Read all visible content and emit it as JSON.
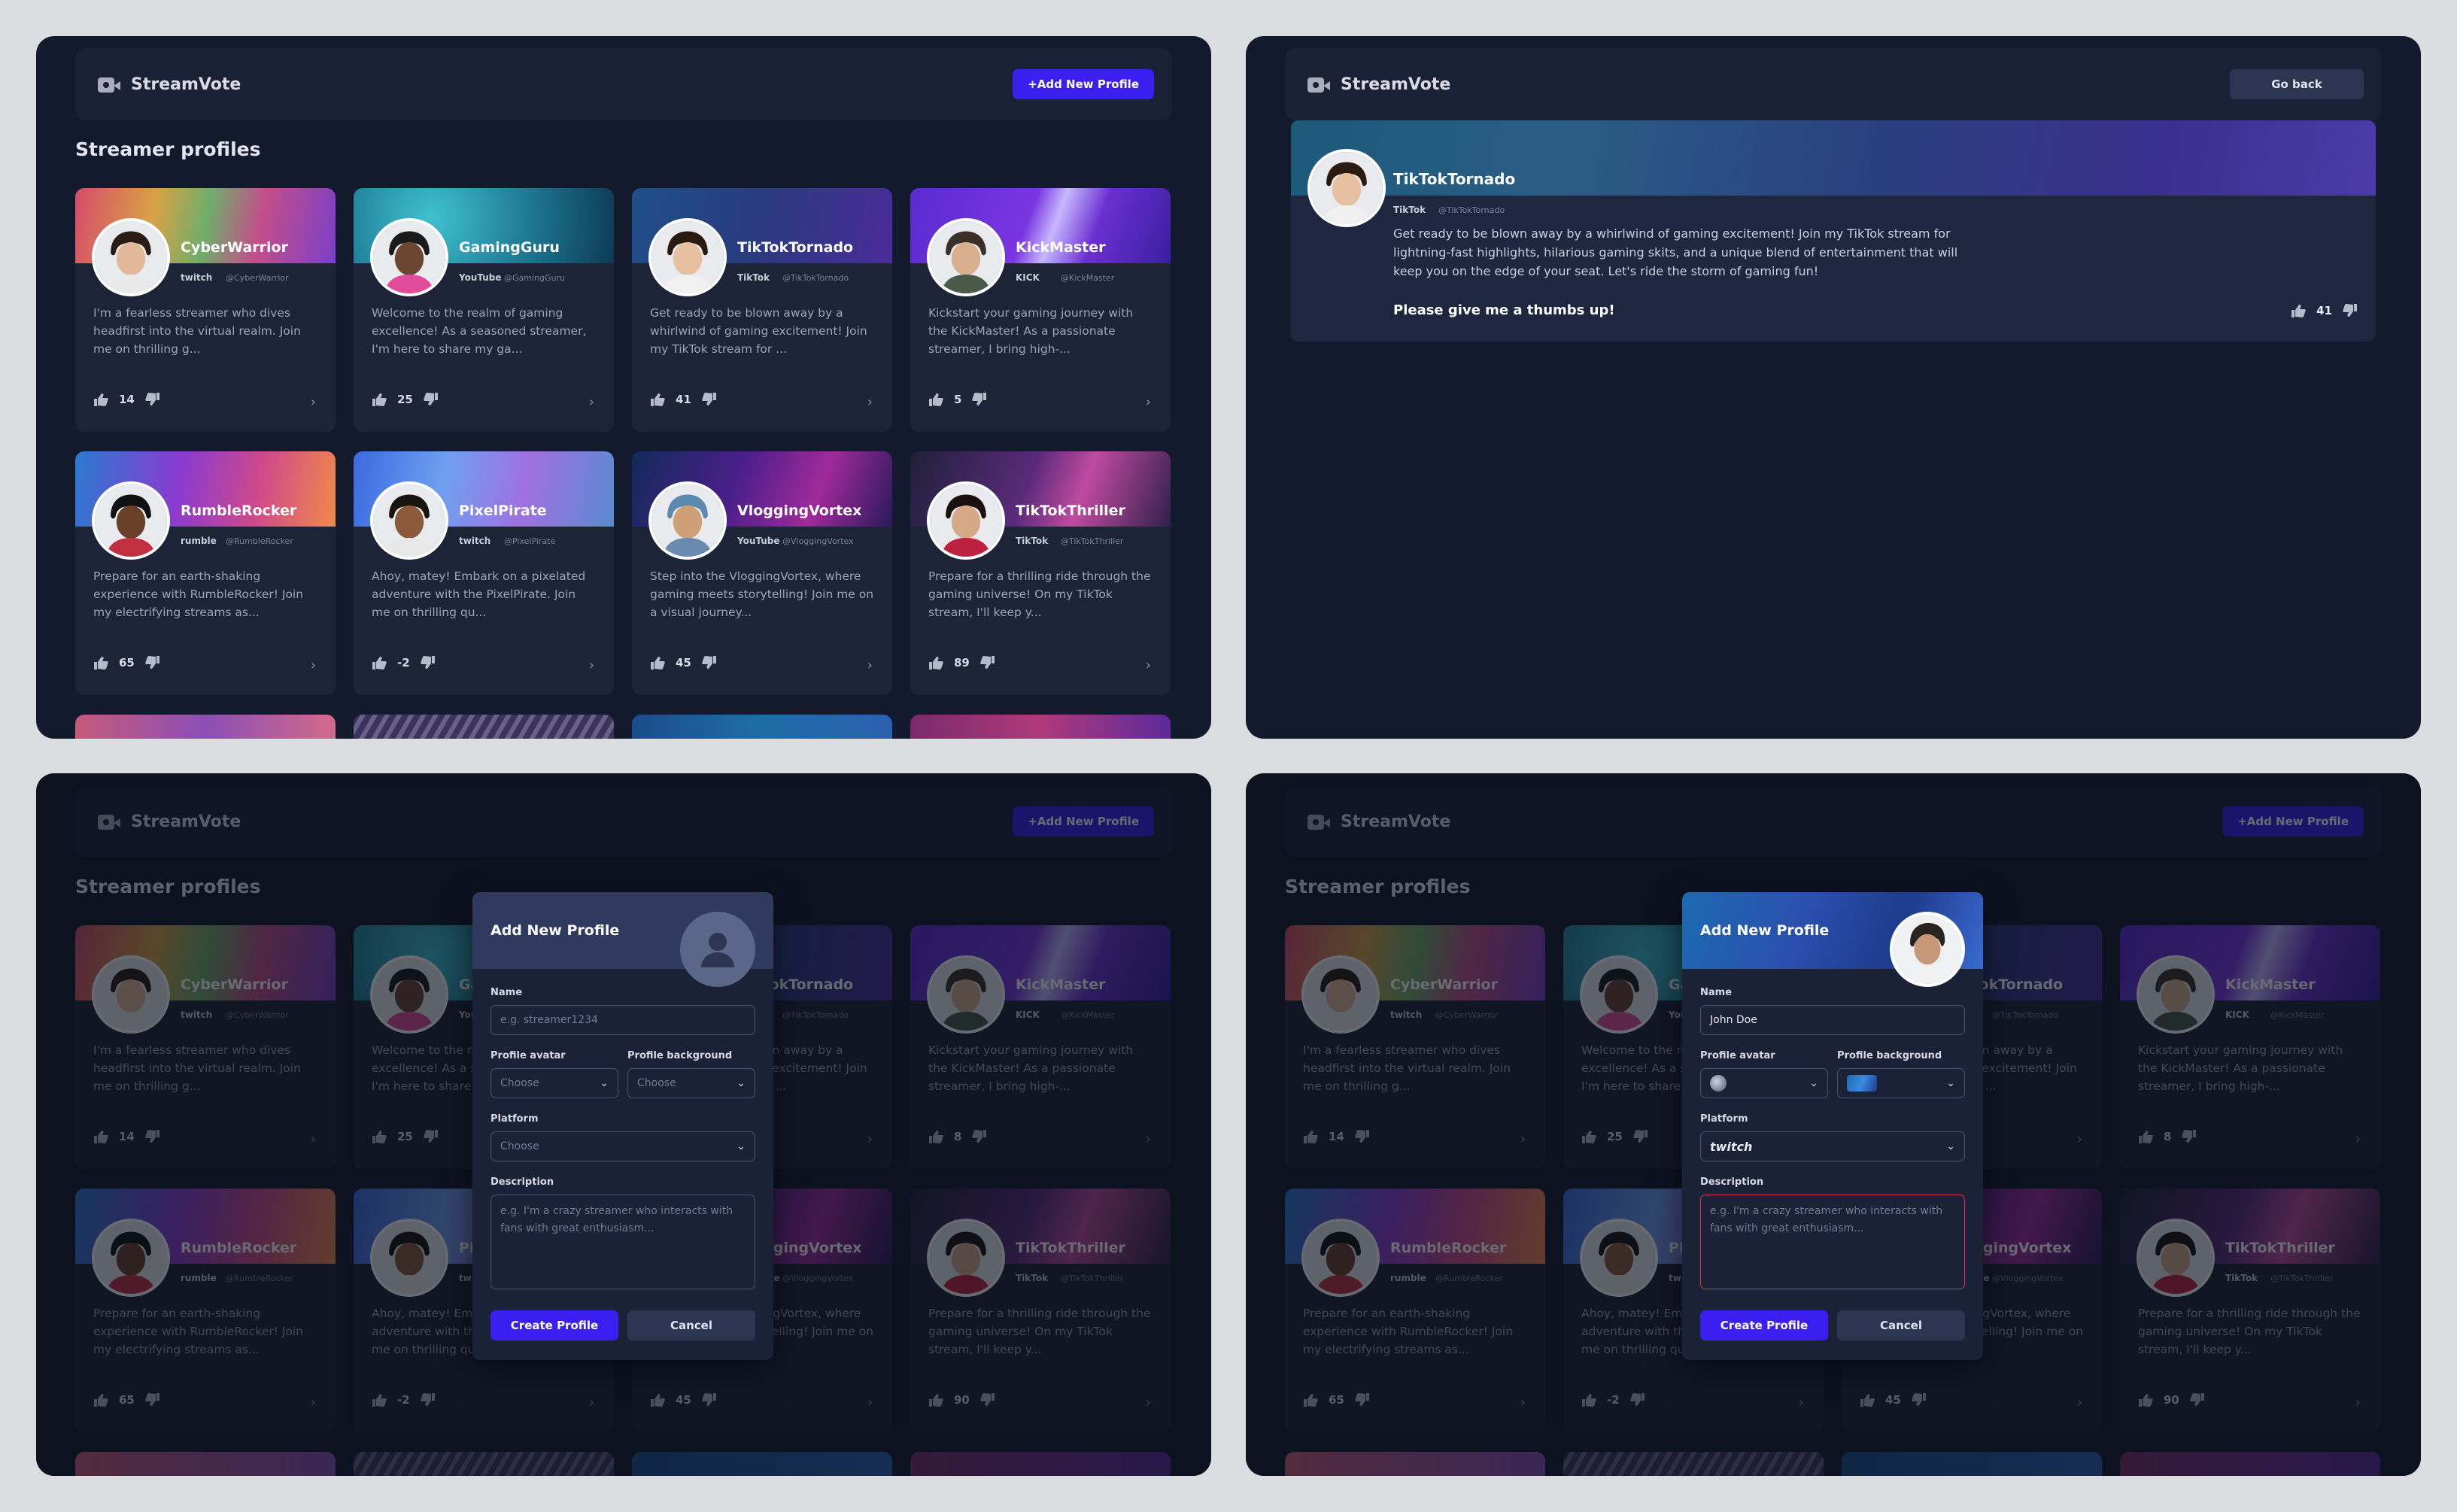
{
  "app": {
    "brand": "StreamVote"
  },
  "header": {
    "add_profile_label": "+Add New Profile",
    "go_back_label": "Go back"
  },
  "list": {
    "title": "Streamer profiles"
  },
  "profiles": [
    {
      "name": "CyberWarrior",
      "platform": "twitch",
      "handle": "@CyberWarrior",
      "description": "I'm a fearless streamer who dives headfirst into the virtual realm. Join me on thrilling g...",
      "votes": "14"
    },
    {
      "name": "GamingGuru",
      "platform": "YouTube",
      "handle": "@GamingGuru",
      "description": "Welcome to the realm of gaming excellence! As a seasoned streamer, I'm here to share my ga...",
      "votes": "25"
    },
    {
      "name": "TikTokTornado",
      "platform": "TikTok",
      "handle": "@TikTokTornado",
      "description": "Get ready to be blown away by a whirlwind of gaming excitement! Join my TikTok stream for ...",
      "votes": "41"
    },
    {
      "name": "KickMaster",
      "platform": "KICK",
      "handle": "@KickMaster",
      "description": "Kickstart your gaming journey with the KickMaster! As a passionate streamer, I bring high-...",
      "votes": "5"
    },
    {
      "name": "RumbleRocker",
      "platform": "rumble",
      "handle": "@RumbleRocker",
      "description": "Prepare for an earth-shaking experience with RumbleRocker! Join my electrifying streams as...",
      "votes": "65"
    },
    {
      "name": "PixelPirate",
      "platform": "twitch",
      "handle": "@PixelPirate",
      "description": "Ahoy, matey! Embark on a pixelated adventure with the PixelPirate. Join me on thrilling qu...",
      "votes": "-2"
    },
    {
      "name": "VloggingVortex",
      "platform": "YouTube",
      "handle": "@VloggingVortex",
      "description": "Step into the VloggingVortex, where gaming meets storytelling! Join me on a visual journey...",
      "votes": "45"
    },
    {
      "name": "TikTokThriller",
      "platform": "TikTok",
      "handle": "@TikTokThriller",
      "description": "Prepare for a thrilling ride through the gaming universe! On my TikTok stream, I'll keep y...",
      "votes": "89"
    }
  ],
  "detail": {
    "name": "TikTokTornado",
    "platform": "TikTok",
    "handle": "@TikTokTornado",
    "description": "Get ready to be blown away by a whirlwind of gaming excitement! Join my TikTok stream for lightning-fast highlights, hilarious gaming skits, and a unique blend of entertainment that will keep you on the edge of your seat. Let's ride the storm of gaming fun!",
    "cta": "Please give me a thumbs up!",
    "votes": "41"
  },
  "faded_votes": [
    "14",
    "25",
    "",
    "8",
    "65",
    "-2",
    "45",
    "90"
  ],
  "modal": {
    "title": "Add New Profile",
    "name_label": "Name",
    "name_placeholder": "e.g. streamer1234",
    "name_value": "John Doe",
    "avatar_label": "Profile avatar",
    "background_label": "Profile background",
    "choose": "Choose",
    "platform_label": "Platform",
    "platform_value": "twitch",
    "description_label": "Description",
    "description_placeholder": "e.g. I'm a crazy streamer who interacts with fans with great enthusiasm...",
    "create_label": "Create Profile",
    "cancel_label": "Cancel"
  },
  "colors": {
    "accent": "#3b1ff0",
    "panel": "#141a2e",
    "card": "#1d2438",
    "error": "#e0324a"
  }
}
